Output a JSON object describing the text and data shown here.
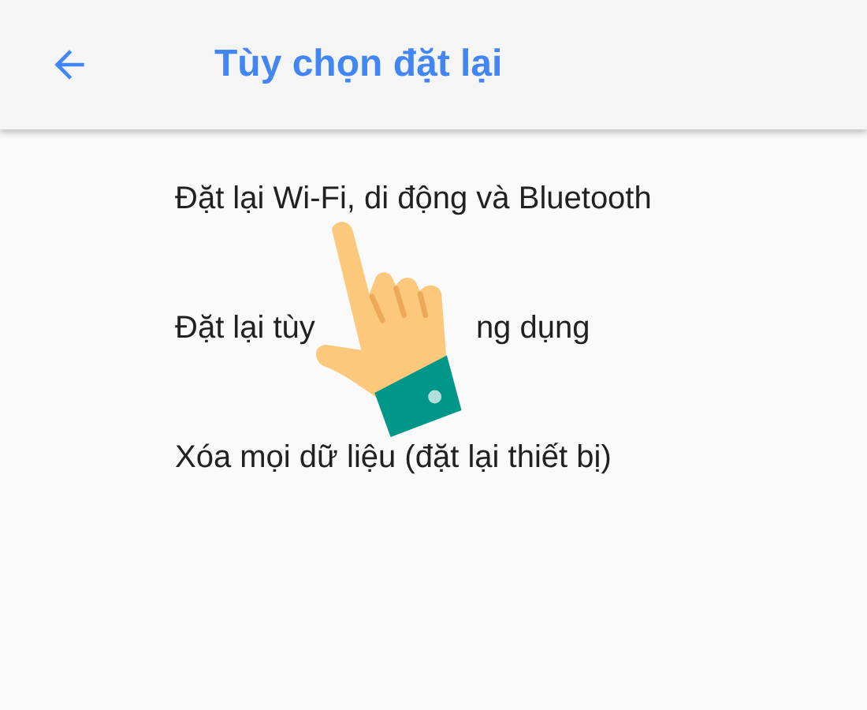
{
  "app_bar": {
    "title": "Tùy chọn đặt lại"
  },
  "options": [
    {
      "segments": [
        "Đặt lại Wi-Fi, di động và Bluetooth"
      ]
    },
    {
      "segments": [
        "Đặt lại tùy",
        "ng dụng"
      ]
    },
    {
      "segments": [
        "Xóa mọi dữ liệu (đặt lại thiết bị)"
      ]
    }
  ]
}
